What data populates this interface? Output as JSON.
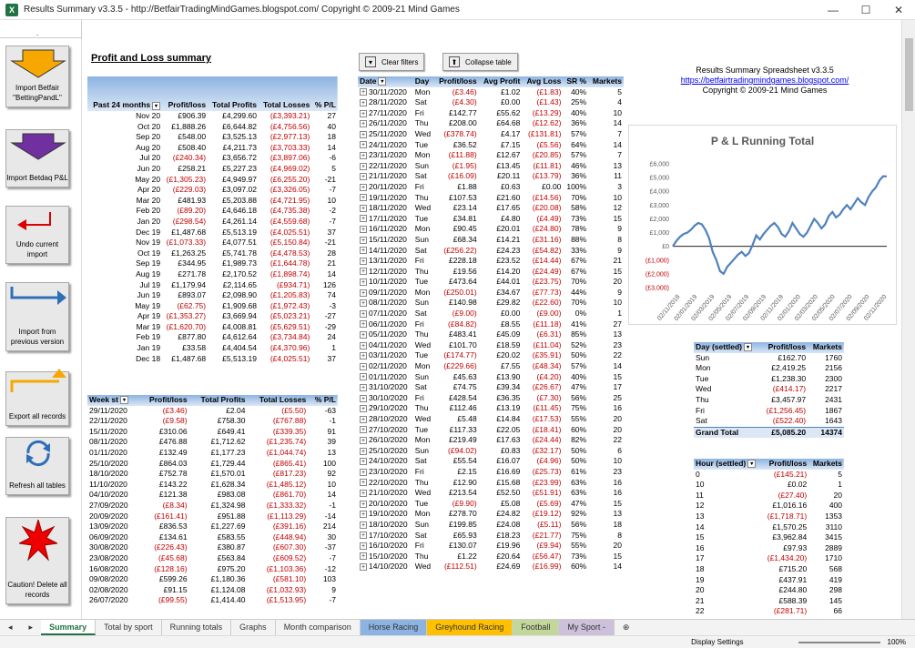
{
  "window": {
    "title": "Results Summary v3.3.5 - http://BetfairTradingMindGames.blogspot.com/ Copyright © 2009-21 Mind Games",
    "min": "—",
    "max": "☐",
    "close": "✕"
  },
  "namebox": {
    "dots": "."
  },
  "macros": [
    {
      "label": "Import Betfair \"BettingPandL\"",
      "icon": "down-arrow-orange"
    },
    {
      "label": "Import Betdaq P&L",
      "icon": "down-arrow-purple"
    },
    {
      "label": "Undo current import",
      "icon": "undo-arrow-red"
    },
    {
      "label": "Import from previous version",
      "icon": "bent-arrow-blue"
    },
    {
      "label": "Export all records",
      "icon": "bent-arrow-orange"
    },
    {
      "label": "Refresh all tables",
      "icon": "refresh-arrows-blue"
    },
    {
      "label": "Caution! Delete all records",
      "icon": "red-star"
    }
  ],
  "pl_title": "Profit and Loss summary",
  "buttons": {
    "clear_filters": "Clear filters",
    "collapse_table": "Collapse table"
  },
  "info": {
    "line1": "Results Summary Spreadsheet v3.3.5",
    "link": "https://betfairtradingmindgames.blogspot.com/",
    "line3": "Copyright © 2009-21 Mind Games"
  },
  "monthly": {
    "headers": [
      "Past 24 months",
      "Profit/loss",
      "Total Profits",
      "Total Losses",
      "% P/L"
    ],
    "rows": [
      [
        "Nov 20",
        "£906.39",
        "£4,299.60",
        "(£3,393.21)",
        "27"
      ],
      [
        "Oct 20",
        "£1,888.26",
        "£6,644.82",
        "(£4,756.56)",
        "40"
      ],
      [
        "Sep 20",
        "£548.00",
        "£3,525.13",
        "(£2,977.13)",
        "18"
      ],
      [
        "Aug 20",
        "£508.40",
        "£4,211.73",
        "(£3,703.33)",
        "14"
      ],
      [
        "Jul 20",
        "(£240.34)",
        "£3,656.72",
        "(£3,897.06)",
        "-6"
      ],
      [
        "Jun 20",
        "£258.21",
        "£5,227.23",
        "(£4,969.02)",
        "5"
      ],
      [
        "May 20",
        "(£1,305.23)",
        "£4,949.97",
        "(£6,255.20)",
        "-21"
      ],
      [
        "Apr 20",
        "(£229.03)",
        "£3,097.02",
        "(£3,326.05)",
        "-7"
      ],
      [
        "Mar 20",
        "£481.93",
        "£5,203.88",
        "(£4,721.95)",
        "10"
      ],
      [
        "Feb 20",
        "(£89.20)",
        "£4,646.18",
        "(£4,735.38)",
        "-2"
      ],
      [
        "Jan 20",
        "(£298.54)",
        "£4,261.14",
        "(£4,559.68)",
        "-7"
      ],
      [
        "Dec 19",
        "£1,487.68",
        "£5,513.19",
        "(£4,025.51)",
        "37"
      ],
      [
        "Nov 19",
        "(£1,073.33)",
        "£4,077.51",
        "(£5,150.84)",
        "-21"
      ],
      [
        "Oct 19",
        "£1,263.25",
        "£5,741.78",
        "(£4,478.53)",
        "28"
      ],
      [
        "Sep 19",
        "£344.95",
        "£1,989.73",
        "(£1,644.78)",
        "21"
      ],
      [
        "Aug 19",
        "£271.78",
        "£2,170.52",
        "(£1,898.74)",
        "14"
      ],
      [
        "Jul 19",
        "£1,179.94",
        "£2,114.65",
        "(£934.71)",
        "126"
      ],
      [
        "Jun 19",
        "£893.07",
        "£2,098.90",
        "(£1,205.83)",
        "74"
      ],
      [
        "May 19",
        "(£62.75)",
        "£1,909.68",
        "(£1,972.43)",
        "-3"
      ],
      [
        "Apr 19",
        "(£1,353.27)",
        "£3,669.94",
        "(£5,023.21)",
        "-27"
      ],
      [
        "Mar 19",
        "(£1,620.70)",
        "£4,008.81",
        "(£5,629.51)",
        "-29"
      ],
      [
        "Feb 19",
        "£877.80",
        "£4,612.64",
        "(£3,734.84)",
        "24"
      ],
      [
        "Jan 19",
        "£33.58",
        "£4,404.54",
        "(£4,370.96)",
        "1"
      ],
      [
        "Dec 18",
        "£1,487.68",
        "£5,513.19",
        "(£4,025.51)",
        "37"
      ]
    ]
  },
  "weekly": {
    "headers": [
      "Week st",
      "Profit/loss",
      "Total Profits",
      "Total Losses",
      "% P/L"
    ],
    "rows": [
      [
        "29/11/2020",
        "(£3.46)",
        "£2.04",
        "(£5.50)",
        "-63"
      ],
      [
        "22/11/2020",
        "(£9.58)",
        "£758.30",
        "(£767.88)",
        "-1"
      ],
      [
        "15/11/2020",
        "£310.06",
        "£649.41",
        "(£339.35)",
        "91"
      ],
      [
        "08/11/2020",
        "£476.88",
        "£1,712.62",
        "(£1,235.74)",
        "39"
      ],
      [
        "01/11/2020",
        "£132.49",
        "£1,177.23",
        "(£1,044.74)",
        "13"
      ],
      [
        "25/10/2020",
        "£864.03",
        "£1,729.44",
        "(£865.41)",
        "100"
      ],
      [
        "18/10/2020",
        "£752.78",
        "£1,570.01",
        "(£817.23)",
        "92"
      ],
      [
        "11/10/2020",
        "£143.22",
        "£1,628.34",
        "(£1,485.12)",
        "10"
      ],
      [
        "04/10/2020",
        "£121.38",
        "£983.08",
        "(£861.70)",
        "14"
      ],
      [
        "27/09/2020",
        "(£8.34)",
        "£1,324.98",
        "(£1,333.32)",
        "-1"
      ],
      [
        "20/09/2020",
        "(£161.41)",
        "£951.88",
        "(£1,113.29)",
        "-14"
      ],
      [
        "13/09/2020",
        "£836.53",
        "£1,227.69",
        "(£391.16)",
        "214"
      ],
      [
        "06/09/2020",
        "£134.61",
        "£583.55",
        "(£448.94)",
        "30"
      ],
      [
        "30/08/2020",
        "(£226.43)",
        "£380.87",
        "(£607.30)",
        "-37"
      ],
      [
        "23/08/2020",
        "(£45.68)",
        "£563.84",
        "(£609.52)",
        "-7"
      ],
      [
        "16/08/2020",
        "(£128.16)",
        "£975.20",
        "(£1,103.36)",
        "-12"
      ],
      [
        "09/08/2020",
        "£599.26",
        "£1,180.36",
        "(£581.10)",
        "103"
      ],
      [
        "02/08/2020",
        "£91.15",
        "£1,124.08",
        "(£1,032.93)",
        "9"
      ],
      [
        "26/07/2020",
        "(£99.55)",
        "£1,414.40",
        "(£1,513.95)",
        "-7"
      ]
    ]
  },
  "daily": {
    "headers": [
      "Date",
      "Day",
      "Profit/loss",
      "Avg Profit",
      "Avg Loss",
      "SR %",
      "Markets"
    ],
    "rows": [
      [
        "30/11/2020",
        "Mon",
        "(£3.46)",
        "£1.02",
        "(£1.83)",
        "40%",
        "5"
      ],
      [
        "28/11/2020",
        "Sat",
        "(£4.30)",
        "£0.00",
        "(£1.43)",
        "25%",
        "4"
      ],
      [
        "27/11/2020",
        "Fri",
        "£142.77",
        "£55.62",
        "(£13.29)",
        "40%",
        "10"
      ],
      [
        "26/11/2020",
        "Thu",
        "£208.00",
        "£64.68",
        "(£12.62)",
        "36%",
        "14"
      ],
      [
        "25/11/2020",
        "Wed",
        "(£378.74)",
        "£4.17",
        "(£131.81)",
        "57%",
        "7"
      ],
      [
        "24/11/2020",
        "Tue",
        "£36.52",
        "£7.15",
        "(£5.56)",
        "64%",
        "14"
      ],
      [
        "23/11/2020",
        "Mon",
        "(£11.88)",
        "£12.67",
        "(£20.85)",
        "57%",
        "7"
      ],
      [
        "22/11/2020",
        "Sun",
        "(£1.95)",
        "£13.45",
        "(£11.81)",
        "46%",
        "13"
      ],
      [
        "21/11/2020",
        "Sat",
        "(£16.09)",
        "£20.11",
        "(£13.79)",
        "36%",
        "11"
      ],
      [
        "20/11/2020",
        "Fri",
        "£1.88",
        "£0.63",
        "£0.00",
        "100%",
        "3"
      ],
      [
        "19/11/2020",
        "Thu",
        "£107.53",
        "£21.60",
        "(£14.56)",
        "70%",
        "10"
      ],
      [
        "18/11/2020",
        "Wed",
        "£23.14",
        "£17.65",
        "(£20.08)",
        "58%",
        "12"
      ],
      [
        "17/11/2020",
        "Tue",
        "£34.81",
        "£4.80",
        "(£4.49)",
        "73%",
        "15"
      ],
      [
        "16/11/2020",
        "Mon",
        "£90.45",
        "£20.01",
        "(£24.80)",
        "78%",
        "9"
      ],
      [
        "15/11/2020",
        "Sun",
        "£68.34",
        "£14.21",
        "(£31.16)",
        "88%",
        "8"
      ],
      [
        "14/11/2020",
        "Sat",
        "(£256.22)",
        "£24.23",
        "(£54.82)",
        "33%",
        "9"
      ],
      [
        "13/11/2020",
        "Fri",
        "£228.18",
        "£23.52",
        "(£14.44)",
        "67%",
        "21"
      ],
      [
        "12/11/2020",
        "Thu",
        "£19.56",
        "£14.20",
        "(£24.49)",
        "67%",
        "15"
      ],
      [
        "10/11/2020",
        "Tue",
        "£473.64",
        "£44.01",
        "(£23.75)",
        "70%",
        "20"
      ],
      [
        "09/11/2020",
        "Mon",
        "(£250.01)",
        "£34.67",
        "(£77.73)",
        "44%",
        "9"
      ],
      [
        "08/11/2020",
        "Sun",
        "£140.98",
        "£29.82",
        "(£22.60)",
        "70%",
        "10"
      ],
      [
        "07/11/2020",
        "Sat",
        "(£9.00)",
        "£0.00",
        "(£9.00)",
        "0%",
        "1"
      ],
      [
        "06/11/2020",
        "Fri",
        "(£84.82)",
        "£8.55",
        "(£11.18)",
        "41%",
        "27"
      ],
      [
        "05/11/2020",
        "Thu",
        "£483.41",
        "£45.09",
        "(£6.31)",
        "85%",
        "13"
      ],
      [
        "04/11/2020",
        "Wed",
        "£101.70",
        "£18.59",
        "(£11.04)",
        "52%",
        "23"
      ],
      [
        "03/11/2020",
        "Tue",
        "(£174.77)",
        "£20.02",
        "(£35.91)",
        "50%",
        "22"
      ],
      [
        "02/11/2020",
        "Mon",
        "(£229.66)",
        "£7.55",
        "(£48.34)",
        "57%",
        "14"
      ],
      [
        "01/11/2020",
        "Sun",
        "£45.63",
        "£13.90",
        "(£4.20)",
        "40%",
        "15"
      ],
      [
        "31/10/2020",
        "Sat",
        "£74.75",
        "£39.34",
        "(£26.67)",
        "47%",
        "17"
      ],
      [
        "30/10/2020",
        "Fri",
        "£428.54",
        "£36.35",
        "(£7.30)",
        "56%",
        "25"
      ],
      [
        "29/10/2020",
        "Thu",
        "£112.46",
        "£13.19",
        "(£11.45)",
        "75%",
        "16"
      ],
      [
        "28/10/2020",
        "Wed",
        "£5.48",
        "£14.84",
        "(£17.53)",
        "55%",
        "20"
      ],
      [
        "27/10/2020",
        "Tue",
        "£117.33",
        "£22.05",
        "(£18.41)",
        "60%",
        "20"
      ],
      [
        "26/10/2020",
        "Mon",
        "£219.49",
        "£17.63",
        "(£24.44)",
        "82%",
        "22"
      ],
      [
        "25/10/2020",
        "Sun",
        "(£94.02)",
        "£0.83",
        "(£32.17)",
        "50%",
        "6"
      ],
      [
        "24/10/2020",
        "Sat",
        "£55.54",
        "£16.07",
        "(£4.96)",
        "50%",
        "10"
      ],
      [
        "23/10/2020",
        "Fri",
        "£2.15",
        "£16.69",
        "(£25.73)",
        "61%",
        "23"
      ],
      [
        "22/10/2020",
        "Thu",
        "£12.90",
        "£15.68",
        "(£23.99)",
        "63%",
        "16"
      ],
      [
        "21/10/2020",
        "Wed",
        "£213.54",
        "£52.50",
        "(£51.91)",
        "63%",
        "16"
      ],
      [
        "20/10/2020",
        "Tue",
        "(£9.90)",
        "£5.08",
        "(£5.69)",
        "47%",
        "15"
      ],
      [
        "19/10/2020",
        "Mon",
        "£278.70",
        "£24.82",
        "(£19.12)",
        "92%",
        "13"
      ],
      [
        "18/10/2020",
        "Sun",
        "£199.85",
        "£24.08",
        "(£5.11)",
        "56%",
        "18"
      ],
      [
        "17/10/2020",
        "Sat",
        "£65.93",
        "£18.23",
        "(£21.77)",
        "75%",
        "8"
      ],
      [
        "16/10/2020",
        "Fri",
        "£130.07",
        "£19.96",
        "(£9.94)",
        "55%",
        "20"
      ],
      [
        "15/10/2020",
        "Thu",
        "£1.22",
        "£20.64",
        "(£56.47)",
        "73%",
        "15"
      ],
      [
        "14/10/2020",
        "Wed",
        "(£112.51)",
        "£24.69",
        "(£16.99)",
        "60%",
        "14"
      ]
    ]
  },
  "day_settled": {
    "headers": [
      "Day (settled)",
      "Profit/loss",
      "Markets"
    ],
    "rows": [
      [
        "Sun",
        "£162.70",
        "1760"
      ],
      [
        "Mon",
        "£2,419.25",
        "2156"
      ],
      [
        "Tue",
        "£1,238.30",
        "2300"
      ],
      [
        "Wed",
        "(£414.17)",
        "2217"
      ],
      [
        "Thu",
        "£3,457.97",
        "2431"
      ],
      [
        "Fri",
        "(£1,256.45)",
        "1867"
      ],
      [
        "Sat",
        "(£522.40)",
        "1643"
      ]
    ],
    "total": [
      "Grand Total",
      "£5,085.20",
      "14374"
    ]
  },
  "hour_settled": {
    "headers": [
      "Hour (settled)",
      "Profit/loss",
      "Markets"
    ],
    "rows": [
      [
        "0",
        "(£145.21)",
        "5"
      ],
      [
        "10",
        "£0.02",
        "1"
      ],
      [
        "11",
        "(£27.40)",
        "20"
      ],
      [
        "12",
        "£1,016.16",
        "400"
      ],
      [
        "13",
        "(£1,718.71)",
        "1353"
      ],
      [
        "14",
        "£1,570.25",
        "3110"
      ],
      [
        "15",
        "£3,962.84",
        "3415"
      ],
      [
        "16",
        "£97.93",
        "2889"
      ],
      [
        "17",
        "(£1,434.20)",
        "1710"
      ],
      [
        "18",
        "£715.20",
        "568"
      ],
      [
        "19",
        "£437.91",
        "419"
      ],
      [
        "20",
        "£244.80",
        "298"
      ],
      [
        "21",
        "£588.39",
        "145"
      ],
      [
        "22",
        "(£281.71)",
        "66"
      ]
    ]
  },
  "chart_data": {
    "type": "line",
    "title": "P & L Running Total",
    "ylim": [
      -3000,
      6000
    ],
    "yticks": [
      "£6,000",
      "£5,000",
      "£4,000",
      "£3,000",
      "£2,000",
      "£1,000",
      "£0",
      "(£1,000)",
      "(£2,000)",
      "(£3,000)"
    ],
    "x_labels": [
      "02/11/2018",
      "02/01/2019",
      "02/03/2019",
      "02/05/2019",
      "02/07/2019",
      "02/09/2019",
      "02/11/2019",
      "02/01/2020",
      "02/03/2020",
      "02/05/2020",
      "02/07/2020",
      "02/09/2020",
      "02/11/2020"
    ],
    "series": [
      {
        "values": [
          0,
          400,
          700,
          900,
          1000,
          1200,
          1500,
          1700,
          1600,
          1200,
          600,
          -400,
          -1000,
          -1800,
          -2000,
          -1500,
          -1200,
          -900,
          -600,
          -400,
          -700,
          -500,
          100,
          800,
          500,
          900,
          1200,
          1500,
          1700,
          1400,
          900,
          700,
          1100,
          1700,
          1300,
          900,
          700,
          1000,
          1500,
          2000,
          1700,
          1300,
          1600,
          2200,
          2500,
          2100,
          2300,
          2700,
          3000,
          2700,
          3100,
          3500,
          3200,
          3000,
          3600,
          4000,
          4300,
          4800,
          5100,
          5085
        ]
      }
    ],
    "color": "#4f81bd"
  },
  "tabs": [
    "Summary",
    "Total by sport",
    "Running totals",
    "Graphs",
    "Month comparison",
    "Horse Racing",
    "Greyhound Racing",
    "Football",
    "My Sport -"
  ],
  "tab_colors": {
    "Horse Racing": "#8db3e2",
    "Greyhound Racing": "#ffc000",
    "Football": "#c4d79b",
    "My Sport -": "#ccc0da"
  },
  "status": {
    "display_settings": "Display Settings",
    "zoom": "100%"
  }
}
